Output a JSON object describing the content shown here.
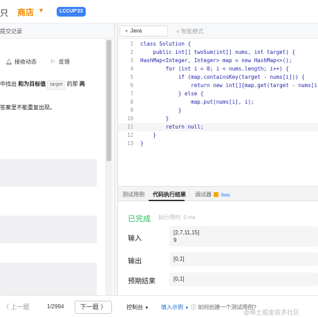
{
  "nav": {
    "item_left": "只",
    "shop": "商店",
    "badge": "LCCUP'23"
  },
  "left_panel": {
    "sub_tab": "提交记录",
    "actions": {
      "dynamic": "接收动态",
      "feedback": "反馈"
    },
    "description": {
      "line1_pre": "中找出 ",
      "line1_bold": "和为目标值",
      "line1_code": "target",
      "line1_post": " 的那 ",
      "line1_end": "两",
      "line2": "答案里不能重复出现。"
    }
  },
  "editor": {
    "language": "Java",
    "smart_mode": "智能模式",
    "lines": [
      {
        "num": "1",
        "code": "class Solution {"
      },
      {
        "num": "2",
        "code": "    public int[] twoSum(int[] nums, int target) {"
      },
      {
        "num": "3",
        "code": "HashMap<Integer, Integer> map = new HashMap<>();"
      },
      {
        "num": "4",
        "code": "        for (int i = 0; i < nums.length; i++) {"
      },
      {
        "num": "5",
        "code": "            if (map.containsKey(target - nums[i])) {"
      },
      {
        "num": "6",
        "code": "                return new int[]{map.get(target - nums[i"
      },
      {
        "num": "7",
        "code": "            } else {"
      },
      {
        "num": "8",
        "code": "                map.put(nums[i], i);"
      },
      {
        "num": "9",
        "code": "            }"
      },
      {
        "num": "10",
        "code": "        }"
      },
      {
        "num": "11",
        "code": "        return null;"
      },
      {
        "num": "12",
        "code": "    }"
      },
      {
        "num": "13",
        "code": "}"
      }
    ]
  },
  "result": {
    "tabs": {
      "testcase": "测试用例",
      "result": "代码执行结果",
      "debugger": "调试器",
      "beta": "Beta"
    },
    "status": "已完成",
    "time": "执行用时: 0 ms",
    "input_label": "输入",
    "input_line1": "[2,7,11,15]",
    "input_line2": "9",
    "output_label": "输出",
    "output_value": "[0,1]",
    "expected_label": "预期结果",
    "expected_value": "[0,1]"
  },
  "bottom": {
    "prev": "上一题",
    "page": "1/2994",
    "next": "下一题",
    "console": "控制台",
    "insert_example": "填入示例",
    "howto": "如何创建一个测试用例?"
  },
  "watermark": "@稀土掘金技术社区",
  "colors": {
    "accent_orange": "#f08c00",
    "badge_blue": "#3b82f6",
    "success_green": "#2db55d",
    "link_blue": "#1a6fd6"
  }
}
